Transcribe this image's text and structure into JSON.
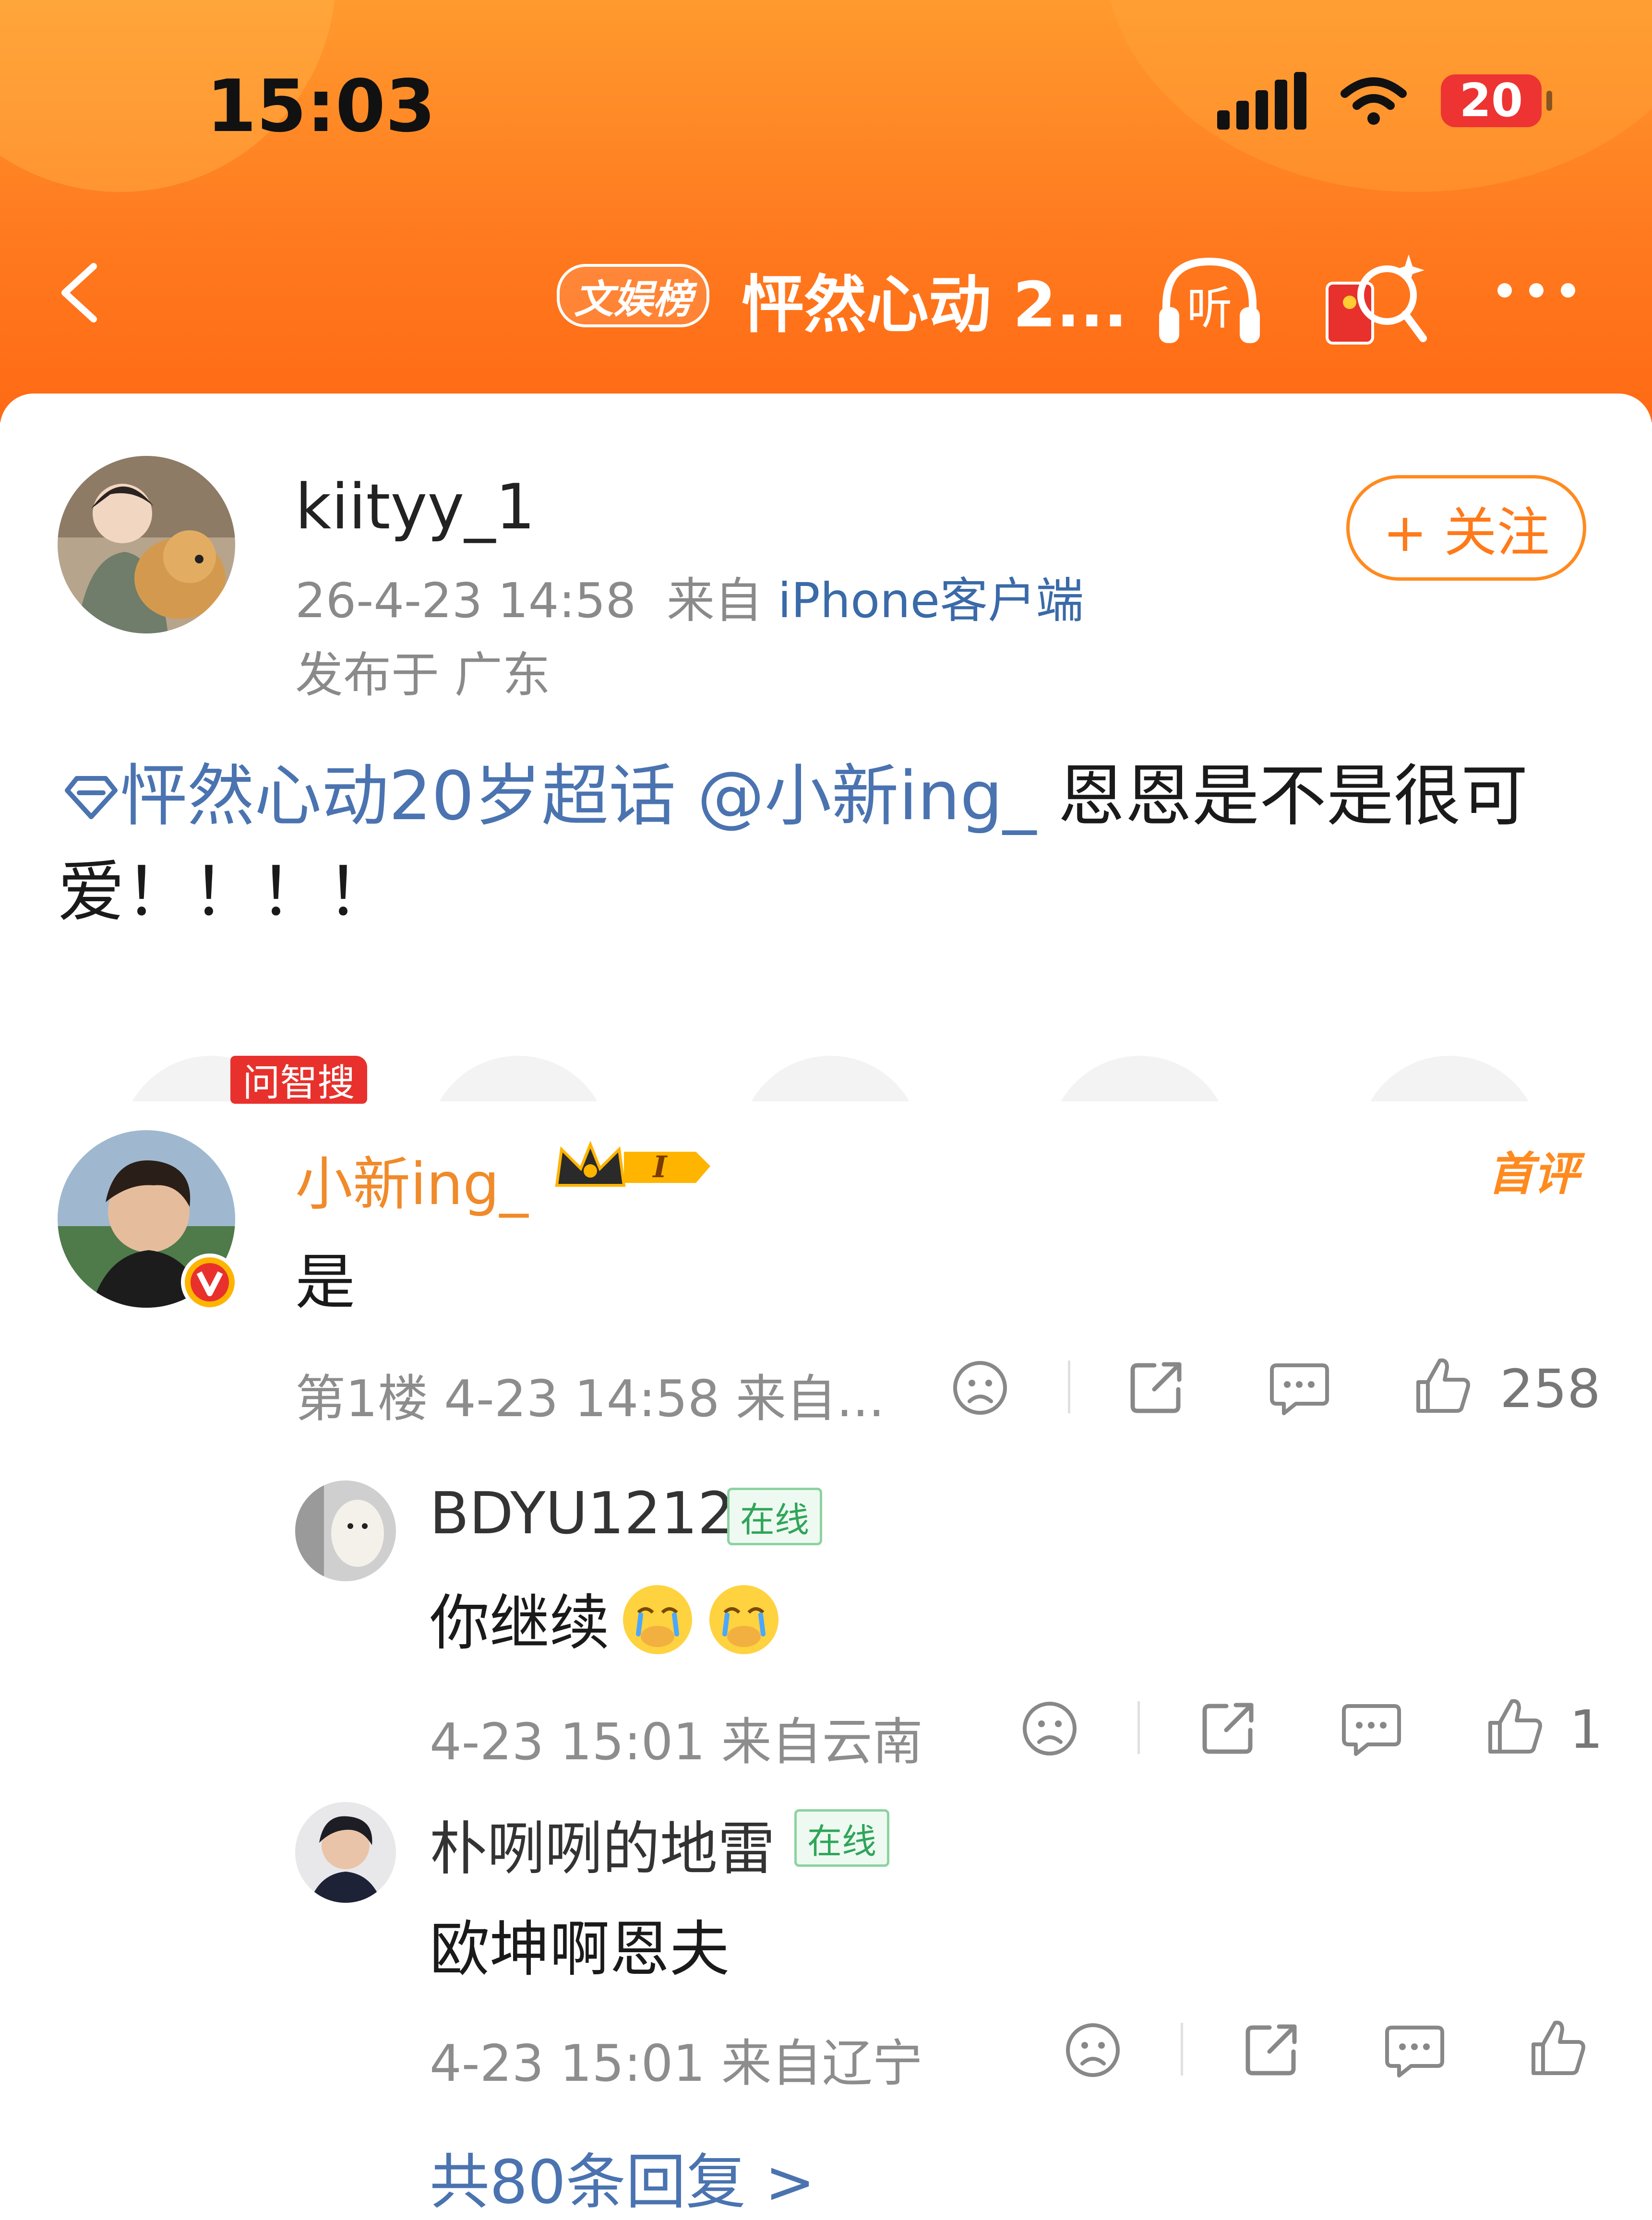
{
  "status_bar": {
    "time": "15:03",
    "battery": "20"
  },
  "nav": {
    "badge": "文娱榜",
    "title": "怦然心动 2...",
    "listen_label": "听"
  },
  "post": {
    "author": "kiityy_1",
    "time": "26-4-23 14:58",
    "source_prefix": "来自",
    "source_client": "iPhone客户端",
    "location": "发布于 广东",
    "follow_label": "+ 关注",
    "topic": "怦然心动20岁超话",
    "mention": "@小新ing_",
    "text": " 恩恩是不是很可爱！！！！"
  },
  "ai_badge": "问智搜",
  "comment": {
    "name": "小新ing_",
    "level": "I",
    "first_badge": "首评",
    "text": "是",
    "meta": "第1楼 4-23 14:58 来自...",
    "likes": "258"
  },
  "replies": [
    {
      "name": "BDYU1212",
      "online": "在线",
      "text": "你继续",
      "meta": "4-23 15:01 来自云南",
      "likes": "1"
    },
    {
      "name": "朴咧咧的地雷",
      "online": "在线",
      "text": "欧坤啊恩夫",
      "meta": "4-23 15:01 来自辽宁",
      "likes": ""
    }
  ],
  "more_replies": "共80条回复 >",
  "colors": {
    "accent": "#ff7a1f",
    "link": "#4a73b0",
    "name_orange": "#f08a2a"
  }
}
